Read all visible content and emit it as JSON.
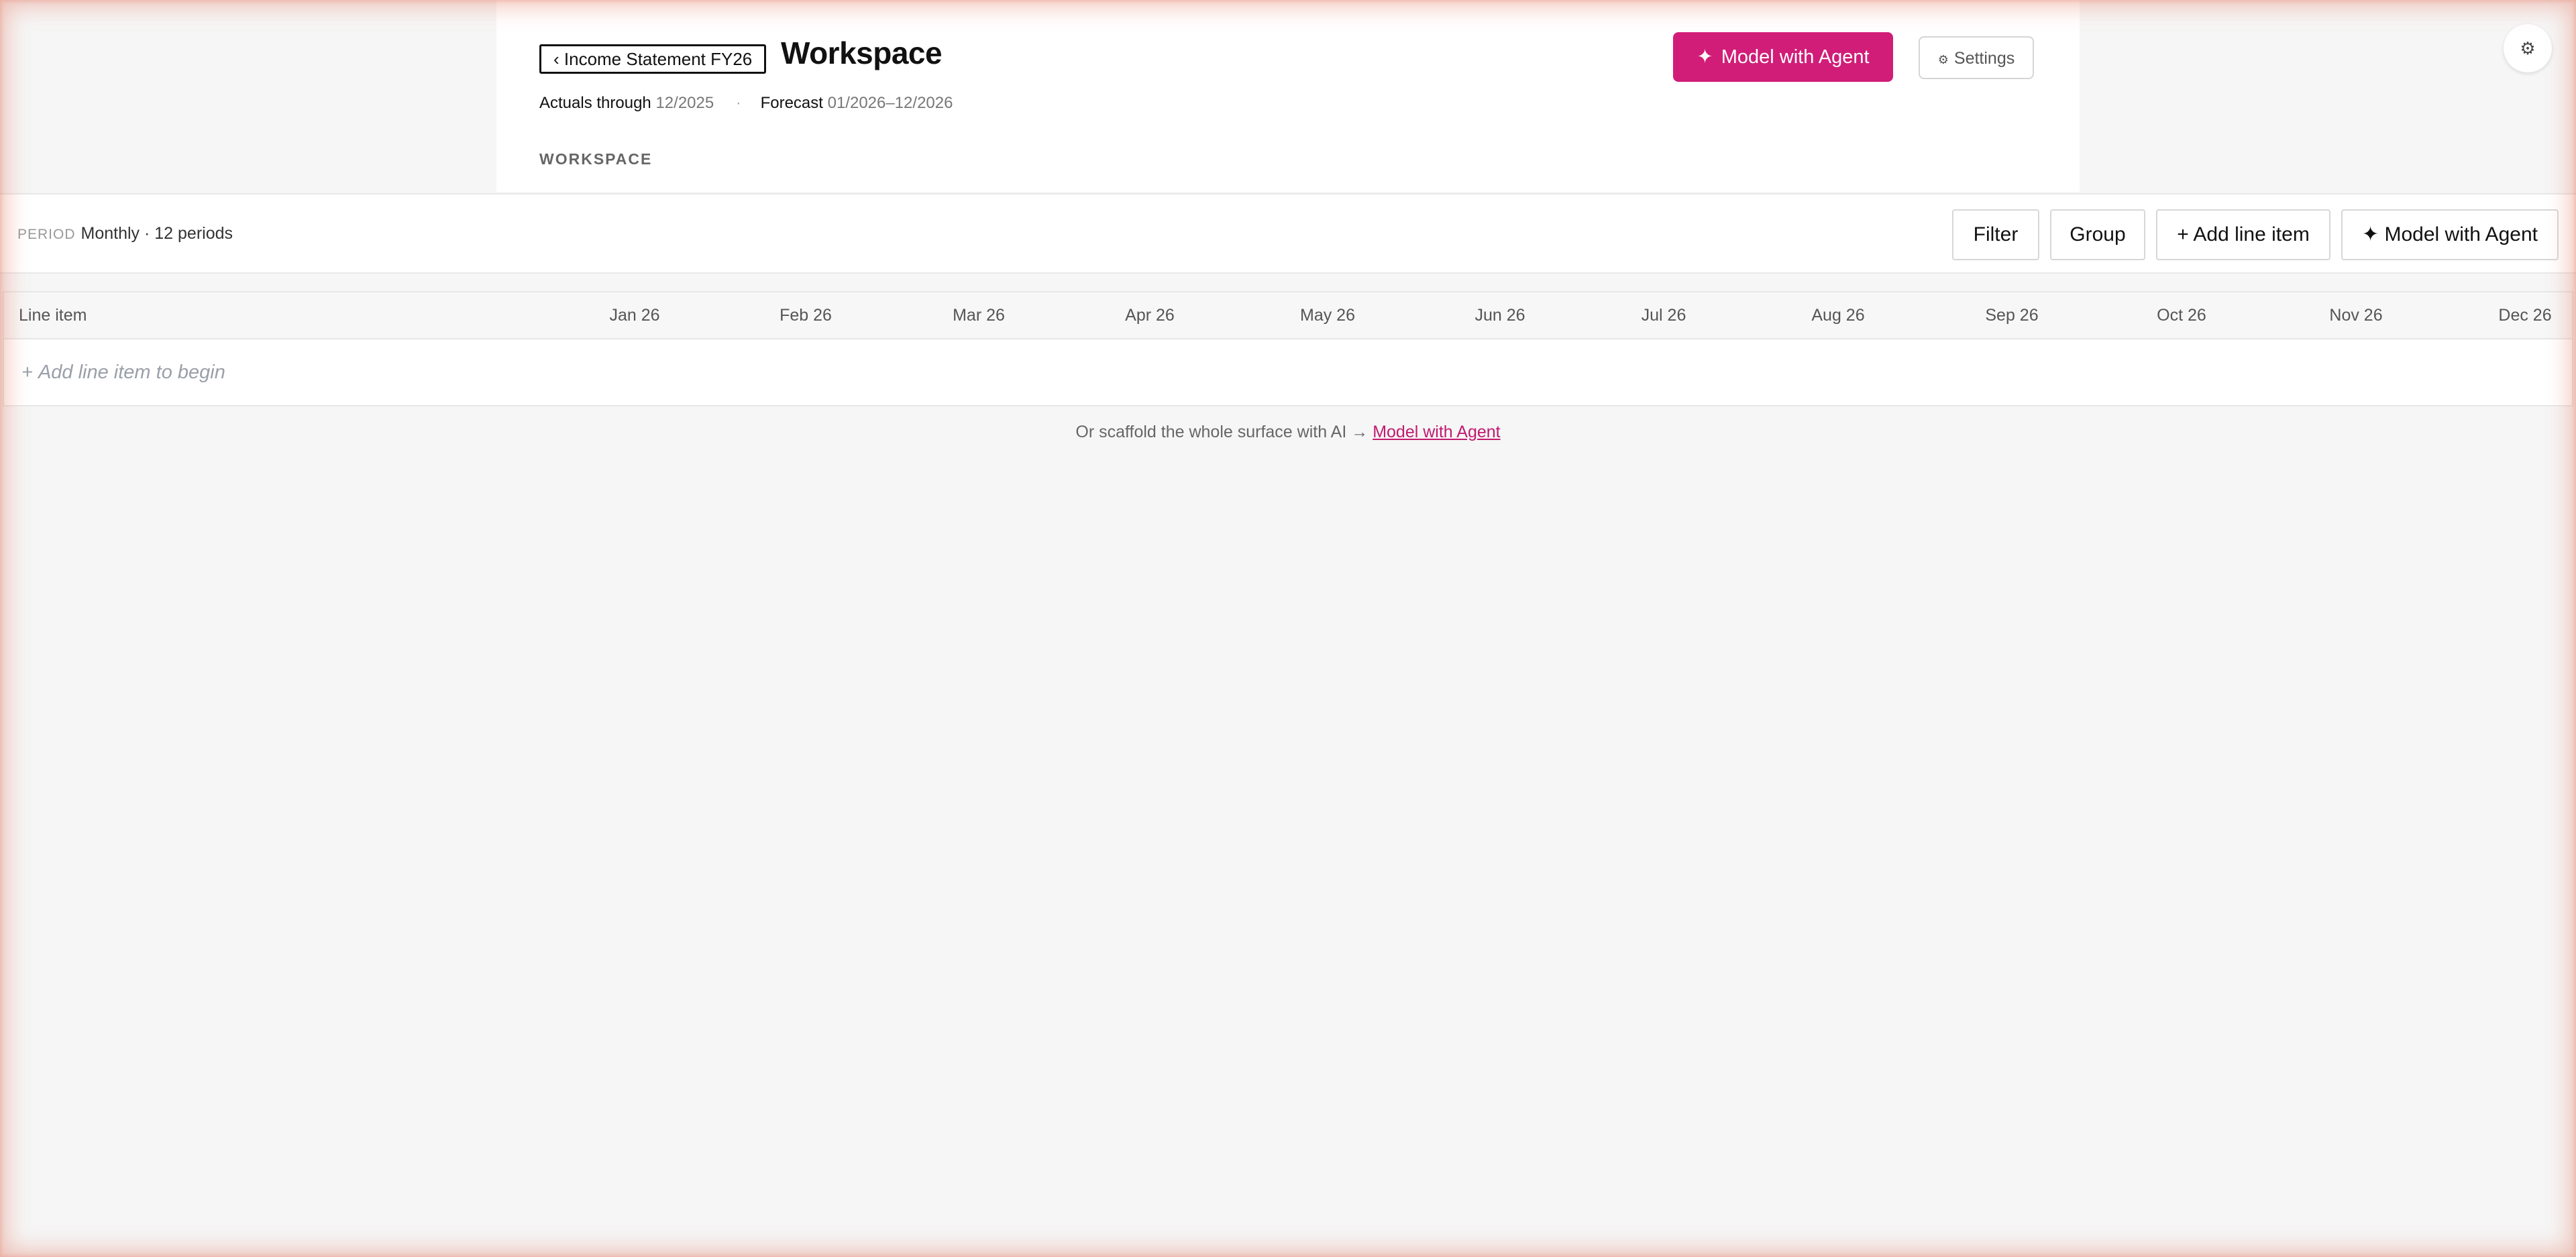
{
  "header": {
    "back_label": "‹ Income Statement FY26",
    "title": "Workspace",
    "actuals_label": "Actuals through",
    "actuals_value": "12/2025",
    "separator": "·",
    "forecast_label": "Forecast",
    "forecast_value": "01/2026–12/2026",
    "section_label": "WORKSPACE",
    "agent_button_icon": "✦",
    "agent_button_label": "Model with Agent",
    "settings_icon": "⚙",
    "settings_label": "Settings"
  },
  "corner": {
    "icon": "⚙"
  },
  "toolbar": {
    "period_label": "PERIOD",
    "period_value": "Monthly · 12 periods",
    "filter_label": "Filter",
    "group_label": "Group",
    "add_line_item_label": "+ Add line item",
    "agent_label": "✦ Model with Agent"
  },
  "table": {
    "first_column": "Line item",
    "months": [
      "Jan 26",
      "Feb 26",
      "Mar 26",
      "Apr 26",
      "May 26",
      "Jun 26",
      "Jul 26",
      "Aug 26",
      "Sep 26",
      "Oct 26",
      "Nov 26",
      "Dec 26"
    ],
    "empty_row_icon": "+",
    "empty_row_label": "Add line item to begin"
  },
  "footer": {
    "hint_text": "Or scaffold the whole surface with AI →",
    "hint_link": "Model with Agent"
  },
  "colors": {
    "accent": "#d11d78",
    "link": "#c21a6f",
    "background": "#f6f6f6",
    "panel": "#ffffff"
  },
  "icons": {
    "settings": "gear-icon",
    "agent": "sparkle-icon",
    "back": "chevron-left-icon",
    "add": "plus-icon"
  }
}
